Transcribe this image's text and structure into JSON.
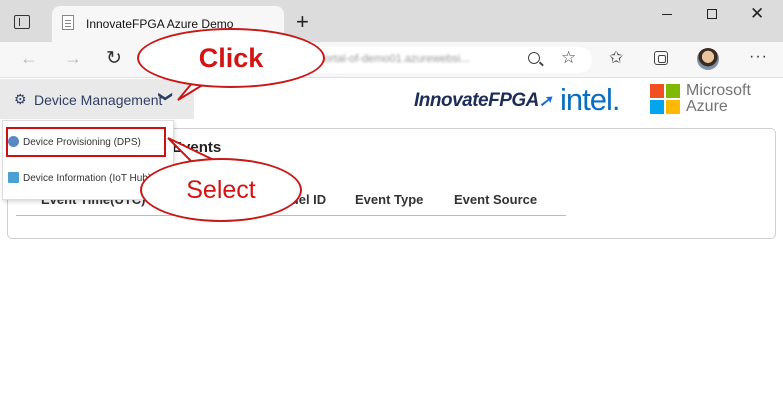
{
  "browser": {
    "tab_title": "InnovateFPGA Azure Demo",
    "new_tab_label": "+",
    "url": "portal-of-demo01.azurewebsi...",
    "icons": [
      "tab-actions-icon",
      "favicon-icon",
      "back-icon",
      "forward-icon",
      "refresh-icon",
      "lock-icon",
      "zoom-icon",
      "add-favorite-icon",
      "favorites-icon",
      "collections-icon",
      "avatar",
      "more-icon"
    ]
  },
  "page": {
    "menu_label": "Device Management",
    "menu_chevron": "❯",
    "logos": {
      "innovate": "InnovateFPGA",
      "intel": "intel.",
      "ms_line1": "Microsoft",
      "ms_line2": "Azure"
    },
    "dropdown": [
      {
        "label": "Device Provisioning (DPS)"
      },
      {
        "label": "Device Information (IoT Hub)"
      }
    ],
    "card_title": "Events",
    "columns": [
      "Event Time(UTC)",
      "Model ID",
      "Event Type",
      "Event Source"
    ]
  },
  "annotations": {
    "click": "Click",
    "select": "Select"
  },
  "colors": {
    "annotation_red": "#c81919",
    "menu_text": "#2e3e63",
    "intel_blue": "#0a6fc3",
    "ms_red": "#f25022",
    "ms_green": "#7fba00",
    "ms_blue": "#00a4ef",
    "ms_yellow": "#ffb900"
  }
}
